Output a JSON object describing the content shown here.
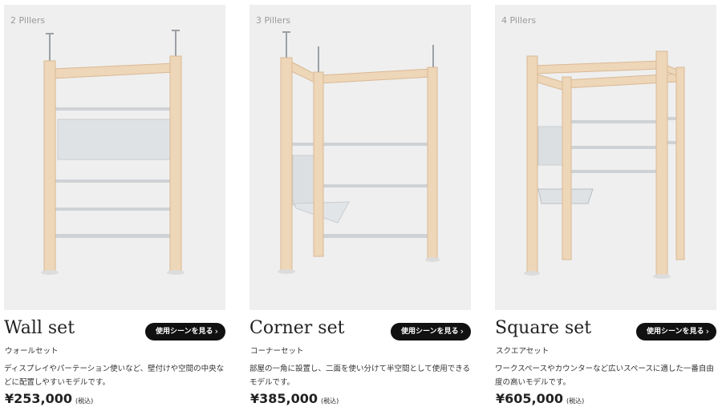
{
  "button_label": "使用シーンを見る",
  "colors": {
    "wood": "#eed6b8",
    "wood_edge": "#d9b994",
    "metal": "#cfd2d5",
    "photo_bg": "#efefef",
    "button_bg": "#111111"
  },
  "icons": {
    "chevron": "chevron-right-icon"
  },
  "products": [
    {
      "pillers": "2 Pillers",
      "title": "Wall set",
      "kana": "ウォールセット",
      "desc": "ディスプレイやパーテーション使いなど、壁付けや空間の中央などに配置しやすいモデルです。",
      "price": "¥253,000",
      "tax": "(税込)"
    },
    {
      "pillers": "3 Pillers",
      "title": "Corner set",
      "kana": "コーナーセット",
      "desc": "部屋の一角に設置し、二面を使い分けて半空間として使用できるモデルです。",
      "price": "¥385,000",
      "tax": "(税込)"
    },
    {
      "pillers": "4 Pillers",
      "title": "Square set",
      "kana": "スクエアセット",
      "desc": "ワークスペースやカウンターなど広いスペースに適した一番自由度の高いモデルです。",
      "price": "¥605,000",
      "tax": "(税込)"
    }
  ]
}
